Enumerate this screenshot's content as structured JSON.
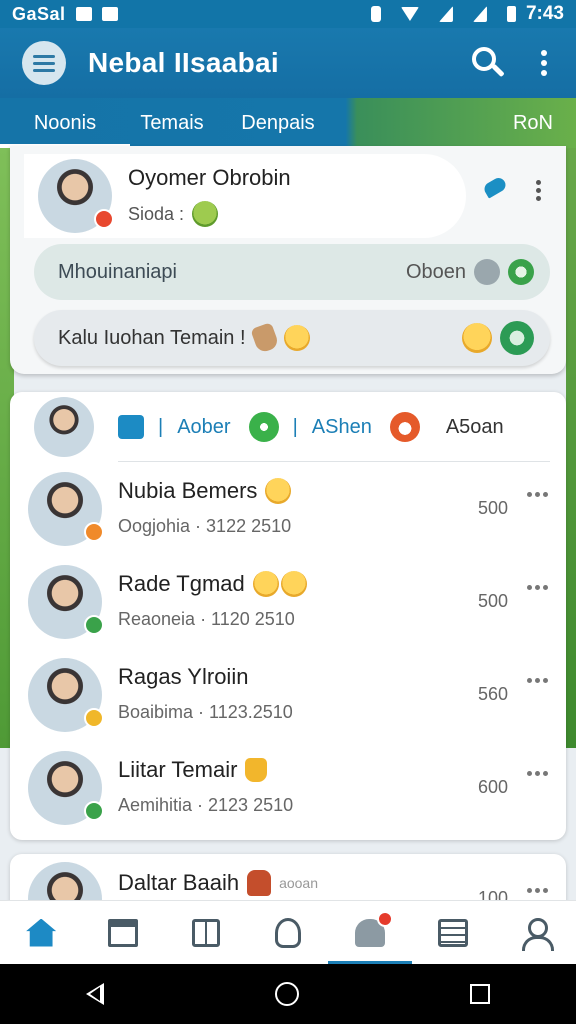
{
  "status_bar": {
    "carrier": "GaSal",
    "time": "7:43"
  },
  "app_bar": {
    "title": "Nebal IIsaabai",
    "icons": [
      "menu-icon",
      "search-icon",
      "more-vert-icon"
    ]
  },
  "tabs": [
    {
      "label": "Noonis",
      "active": true
    },
    {
      "label": "Temais",
      "active": false
    },
    {
      "label": "Denpais",
      "active": false
    },
    {
      "label": "RoN",
      "active": false
    }
  ],
  "featured": {
    "name": "Oyomer Obrobin",
    "status": "Sioda :",
    "pill_1": {
      "label": "Mhouinaniapi",
      "right_text": "Oboen"
    },
    "pill_2": {
      "label": "Kalu Iuohan Temain !"
    }
  },
  "filters": [
    {
      "label": "Aober",
      "icon": "document-icon"
    },
    {
      "label": "AShen",
      "icon": "leaf-icon"
    },
    {
      "label": "A5oan",
      "icon": "heart-icon"
    }
  ],
  "conversations": [
    {
      "name": "Nubia Bemers",
      "sub": "Oogjohia · 3122 2510",
      "count": "500",
      "status_color": "#f08a2a"
    },
    {
      "name": "Rade Tgmad",
      "sub": "Reaoneia · 1120 2510",
      "count": "500",
      "status_color": "#3aa24a"
    },
    {
      "name": "Ragas Ylroiin",
      "sub": "Boaibima · 1123.2510",
      "count": "560",
      "status_color": "#f0b72a"
    },
    {
      "name": "Liitar Temair",
      "sub": "Aemihitia · 2123 2510",
      "count": "600",
      "status_color": "#3aa24a"
    }
  ],
  "peek": {
    "name": "Daltar Baaih",
    "small": "aooan",
    "count": "100"
  },
  "bottom_nav": [
    "home-icon",
    "bank-icon",
    "board-icon",
    "plant-icon",
    "bell-icon",
    "list-icon",
    "profile-icon"
  ]
}
